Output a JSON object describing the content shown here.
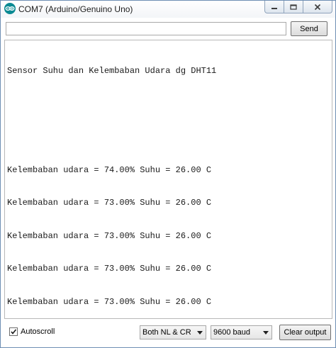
{
  "window": {
    "title": "COM7 (Arduino/Genuino Uno)",
    "app_icon": "arduino-icon"
  },
  "send_bar": {
    "input_value": "",
    "send_label": "Send"
  },
  "output": {
    "lines": [
      "Sensor Suhu dan Kelembaban Udara dg DHT11",
      "",
      "",
      "Kelembaban udara = 74.00% Suhu = 26.00 C",
      "Kelembaban udara = 73.00% Suhu = 26.00 C",
      "Kelembaban udara = 73.00% Suhu = 26.00 C",
      "Kelembaban udara = 73.00% Suhu = 26.00 C",
      "Kelembaban udara = 73.00% Suhu = 26.00 C"
    ]
  },
  "bottom_bar": {
    "autoscroll_label": "Autoscroll",
    "autoscroll_checked": true,
    "line_ending": "Both NL & CR",
    "baud_rate": "9600 baud",
    "clear_label": "Clear output"
  },
  "colors": {
    "app_icon": "#0a8a93",
    "window_border": "#6e8fb4"
  }
}
